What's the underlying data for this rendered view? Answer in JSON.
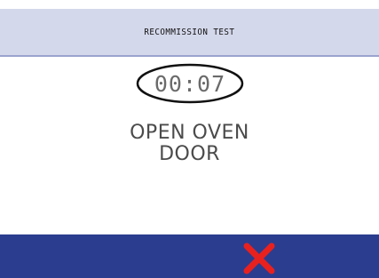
{
  "header": {
    "title": "RECOMMISSION TEST"
  },
  "timer": {
    "value": "00:07"
  },
  "message": {
    "line1": "OPEN OVEN",
    "line2": "DOOR"
  },
  "footer": {
    "cancel_icon": "close-icon"
  },
  "colors": {
    "header_bg": "#d4d8eb",
    "footer_bg": "#2b3d8f",
    "cancel_red": "#e8211f"
  }
}
